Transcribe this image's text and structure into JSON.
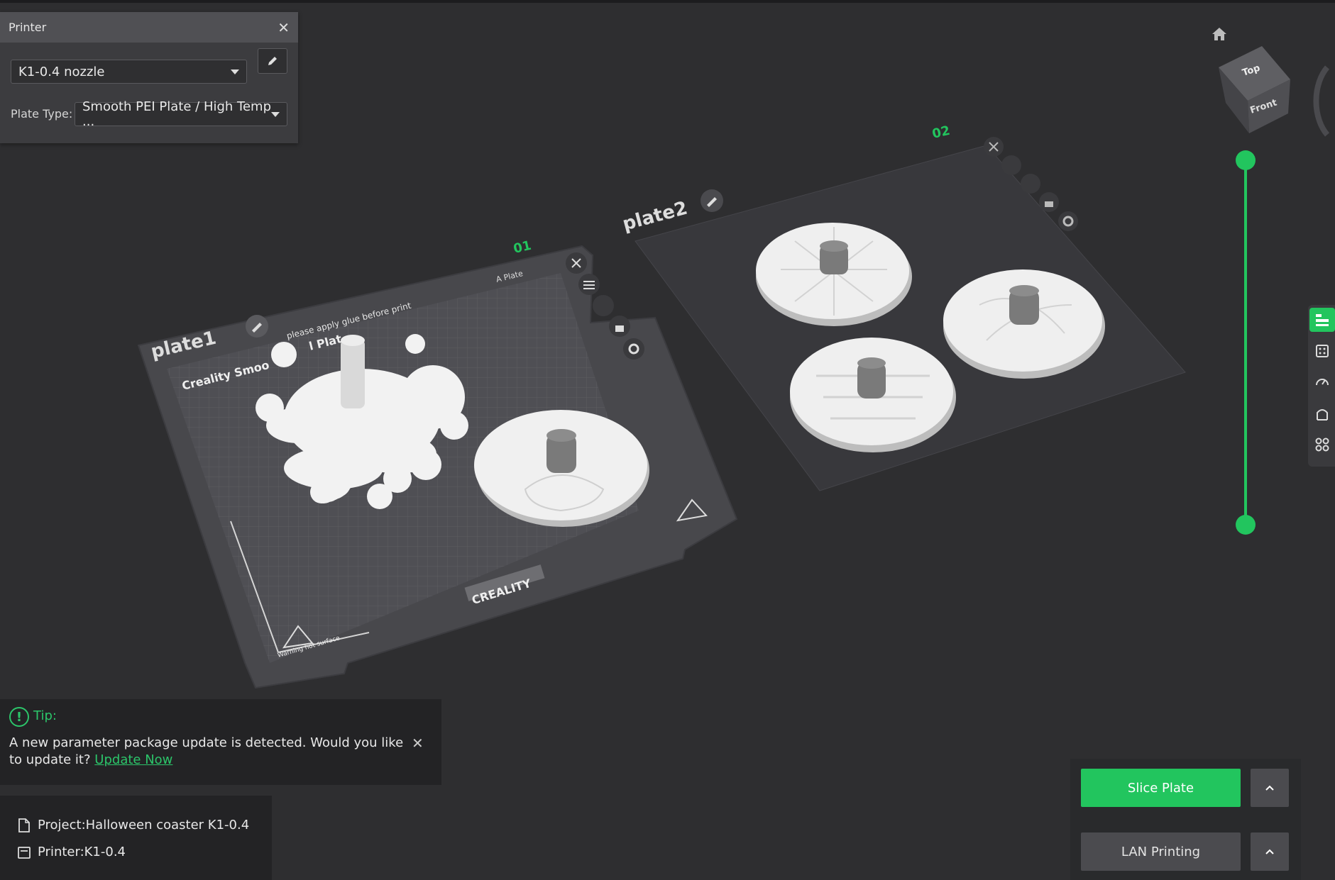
{
  "printer_panel": {
    "title": "Printer",
    "printer_value": "K1-0.4 nozzle",
    "plate_type_label": "Plate Type:",
    "plate_type_value": "Smooth PEI Plate / High Temp ..."
  },
  "plates": {
    "plate1": {
      "name": "plate1",
      "number": "01",
      "plate_tag": "A Plate",
      "notice": "please apply glue before print",
      "surface_text": "Creality Smoo",
      "surface_text_2": "l Plat",
      "brand": "CREALITY",
      "warning": "Warning hot surface"
    },
    "plate2": {
      "name": "plate2",
      "number": "02"
    }
  },
  "view_cube": {
    "top": "Top",
    "front": "Front"
  },
  "tip": {
    "title": "Tip:",
    "message": "A new parameter package update is detected. Would you like to update it?",
    "link": "Update Now"
  },
  "project": {
    "project_label": "Project:Halloween coaster K1-0.4",
    "printer_label": "Printer:K1-0.4"
  },
  "actions": {
    "slice_label": "Slice Plate",
    "lan_label": "LAN Printing"
  },
  "colors": {
    "accent": "#22c55e",
    "background": "#2e2e30",
    "panel": "#3c3c3f"
  }
}
